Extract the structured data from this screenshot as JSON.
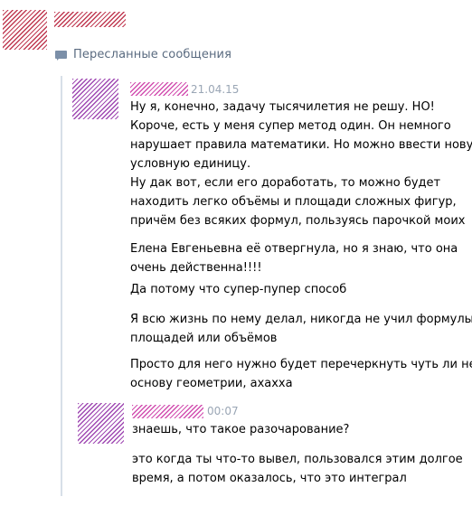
{
  "forwarded_label": "Пересланные сообщения",
  "messages": [
    {
      "date": "21.04.15",
      "paragraphs": [
        [
          "Ну я, конечно, задачу тысячилетия не решу. НО!",
          "Короче, есть у меня супер метод один. Он немного",
          "нарушает правила математики. Но можно ввести новую",
          "условную единицу.",
          "Ну дак вот, если его доработать, то можно будет",
          "находить легко объёмы и площади сложных фигур,",
          "причём без всяких формул, пользуясь парочкой моих"
        ],
        [
          "Елена Евгеньевна её отвергнула, но я знаю, что она",
          "очень действенна!!!!"
        ],
        [
          "Да потому что супер-пупер способ"
        ],
        [
          "Я всю жизнь по нему делал, никогда не учил формулы",
          "площадей или объёмов"
        ],
        [
          "Просто для него нужно будет перечеркнуть чуть ли не",
          "основу геометрии, ахахха"
        ]
      ]
    },
    {
      "date": "00:07",
      "paragraphs": [
        [
          "знаешь, что такое разочарование?"
        ],
        [
          "это когда ты что-то вывел, пользовался этим долгое",
          "время, а потом оказалось, что это интеграл"
        ]
      ]
    }
  ]
}
